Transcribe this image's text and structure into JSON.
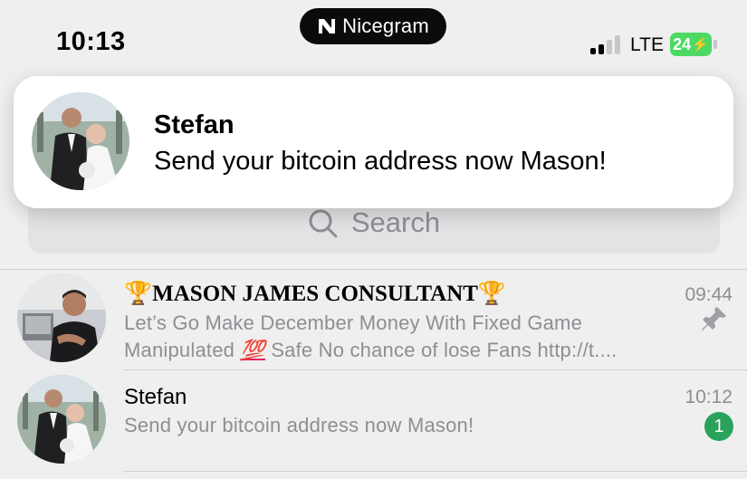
{
  "status_bar": {
    "time": "10:13",
    "app_name": "Nicegram",
    "network": "LTE",
    "battery": "24"
  },
  "notification": {
    "title": "Stefan",
    "body": "Send your bitcoin address now Mason!"
  },
  "search": {
    "placeholder": "Search"
  },
  "chats": [
    {
      "name_prefix": "🏆",
      "name": "MASON JAMES CONSULTANT",
      "name_suffix": "🏆",
      "time": "09:44",
      "preview_line1": "Let’s Go Make December Money With Fixed Game",
      "preview_line2_a": "Manipulated",
      "preview_line2_emoji": "💯",
      "preview_line2_b": "Safe No chance of lose Fans http://t....",
      "pinned": true
    },
    {
      "name": "Stefan",
      "time": "10:12",
      "preview": "Send your bitcoin address now Mason!",
      "unread": "1"
    }
  ],
  "colors": {
    "background": "#efeff0",
    "badge": "#2aa25b",
    "battery": "#4cd964",
    "secondary_text": "#8e8e93"
  }
}
